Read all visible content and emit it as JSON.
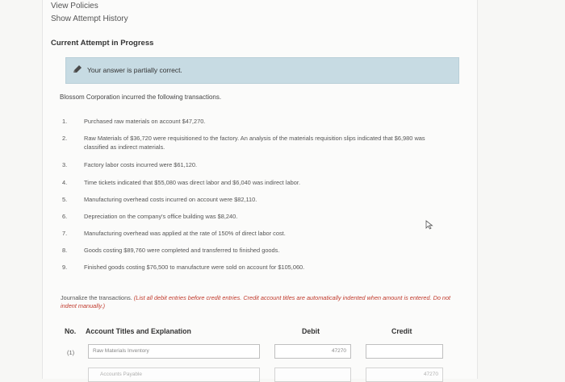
{
  "nav": {
    "view_policies": "View Policies",
    "show_attempt_history": "Show Attempt History"
  },
  "attempt": {
    "title": "Current Attempt in Progress",
    "status": "Your answer is partially correct."
  },
  "problem": {
    "intro": "Blossom Corporation incurred the following transactions.",
    "transactions": [
      {
        "num": "1.",
        "text": "Purchased raw materials on account $47,270."
      },
      {
        "num": "2.",
        "text": "Raw Materials of $36,720 were requisitioned to the factory. An analysis of the materials requisition slips indicated that $6,980 was classified as indirect materials."
      },
      {
        "num": "3.",
        "text": "Factory labor costs incurred were $61,120."
      },
      {
        "num": "4.",
        "text": "Time tickets indicated that $55,080 was direct labor and $6,040 was indirect labor."
      },
      {
        "num": "5.",
        "text": "Manufacturing overhead costs incurred on account were $82,110."
      },
      {
        "num": "6.",
        "text": "Depreciation on the company's office building was $8,240."
      },
      {
        "num": "7.",
        "text": "Manufacturing overhead was applied at the rate of 150% of direct labor cost."
      },
      {
        "num": "8.",
        "text": "Goods costing $89,760 were completed and transferred to finished goods."
      },
      {
        "num": "9.",
        "text": "Finished goods costing $76,500 to manufacture were sold on account for $105,060."
      }
    ],
    "instruction_plain": "Journalize the transactions. ",
    "instruction_emphasis": "(List all debit entries before credit entries. Credit account titles are automatically indented when amount is entered. Do not indent manually.)"
  },
  "table": {
    "col_no": "No.",
    "col_account": "Account Titles and Explanation",
    "col_debit": "Debit",
    "col_credit": "Credit",
    "row1": {
      "num": "(1)",
      "account": "Raw Materials Inventory",
      "debit": "47270",
      "credit": "",
      "account2": "Accounts Payable",
      "credit2": "47270"
    }
  }
}
